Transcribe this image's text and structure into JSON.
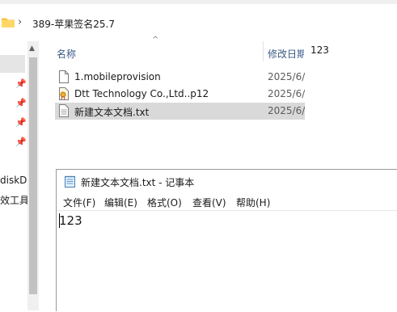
{
  "explorer": {
    "address": {
      "path": "389-苹果签名25.7"
    },
    "columns": {
      "name": "名称",
      "date": "修改日期"
    },
    "files": [
      {
        "name": "1.mobileprovision",
        "date": "2025/6/",
        "icon": "file-icon"
      },
      {
        "name": "Dtt Technology Co.,Ltd..p12",
        "date": "2025/6/",
        "icon": "certificate-icon"
      },
      {
        "name": "新建文本文档.txt",
        "date": "2025/6/",
        "icon": "text-file-icon",
        "selected": true
      }
    ],
    "nav": {
      "disk_label": "diskD",
      "tools_label": "效工具"
    },
    "preview_text": "123"
  },
  "notepad": {
    "title": "新建文本文档.txt - 记事本",
    "menu": [
      "文件(F)",
      "编辑(E)",
      "格式(O)",
      "查看(V)",
      "帮助(H)"
    ],
    "content": "123"
  }
}
